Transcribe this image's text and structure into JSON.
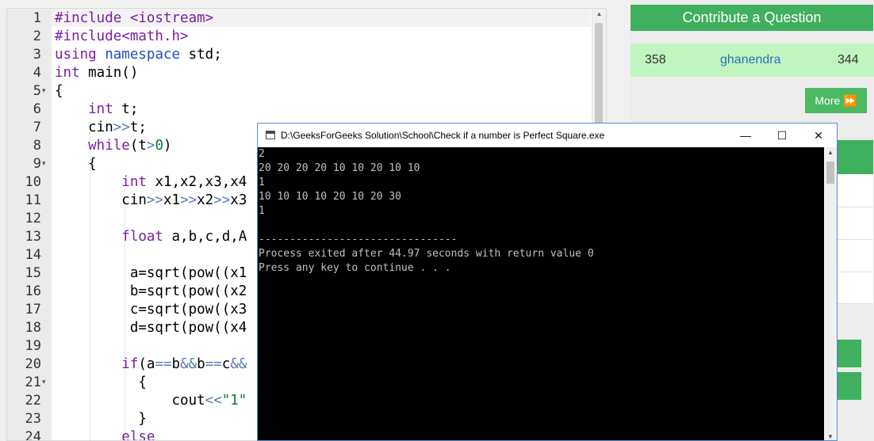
{
  "editor": {
    "line_numbers": [
      "1",
      "2",
      "3",
      "4",
      "5",
      "6",
      "7",
      "8",
      "9",
      "10",
      "11",
      "12",
      "13",
      "14",
      "15",
      "16",
      "17",
      "18",
      "19",
      "20",
      "21",
      "22",
      "23",
      "24"
    ],
    "fold_markers": [
      "5",
      "9",
      "21"
    ],
    "lines": [
      [
        {
          "t": "#include <iostream>",
          "c": "#7b1fa2"
        }
      ],
      [
        {
          "t": "#include<math.h>",
          "c": "#7b1fa2"
        }
      ],
      [
        {
          "t": "using",
          "c": "#7b1fa2"
        },
        {
          "t": " namespace",
          "c": "#1f4fb3"
        },
        {
          "t": " std;",
          "c": "#000000"
        }
      ],
      [
        {
          "t": "int",
          "c": "#7b1fa2"
        },
        {
          "t": " main()",
          "c": "#000000"
        }
      ],
      [
        {
          "t": "{",
          "c": "#000000"
        }
      ],
      [
        {
          "t": "    int",
          "c": "#7b1fa2"
        },
        {
          "t": " t;",
          "c": "#000000"
        }
      ],
      [
        {
          "t": "    cin",
          "c": "#000000"
        },
        {
          "t": ">>",
          "c": "#5b7bb8"
        },
        {
          "t": "t;",
          "c": "#000000"
        }
      ],
      [
        {
          "t": "    while",
          "c": "#7b1fa2"
        },
        {
          "t": "(t",
          "c": "#000000"
        },
        {
          "t": ">",
          "c": "#5b7bb8"
        },
        {
          "t": "0",
          "c": "#0a7a2f"
        },
        {
          "t": ")",
          "c": "#000000"
        }
      ],
      [
        {
          "t": "    {",
          "c": "#000000"
        }
      ],
      [
        {
          "t": "        int",
          "c": "#7b1fa2"
        },
        {
          "t": " x1,x2,x3,x4",
          "c": "#000000"
        }
      ],
      [
        {
          "t": "        cin",
          "c": "#000000"
        },
        {
          "t": ">>",
          "c": "#5b7bb8"
        },
        {
          "t": "x1",
          "c": "#000000"
        },
        {
          "t": ">>",
          "c": "#5b7bb8"
        },
        {
          "t": "x2",
          "c": "#000000"
        },
        {
          "t": ">>",
          "c": "#5b7bb8"
        },
        {
          "t": "x3",
          "c": "#000000"
        }
      ],
      [
        {
          "t": "",
          "c": "#000000"
        }
      ],
      [
        {
          "t": "        float",
          "c": "#7b1fa2"
        },
        {
          "t": " a,b,c,d,A",
          "c": "#000000"
        }
      ],
      [
        {
          "t": "",
          "c": "#000000"
        }
      ],
      [
        {
          "t": "         a=sqrt(pow((x1",
          "c": "#000000"
        }
      ],
      [
        {
          "t": "         b=sqrt(pow((x2",
          "c": "#000000"
        }
      ],
      [
        {
          "t": "         c=sqrt(pow((x3",
          "c": "#000000"
        }
      ],
      [
        {
          "t": "         d=sqrt(pow((x4",
          "c": "#000000"
        }
      ],
      [
        {
          "t": "",
          "c": "#000000"
        }
      ],
      [
        {
          "t": "        if",
          "c": "#7b1fa2"
        },
        {
          "t": "(a",
          "c": "#000000"
        },
        {
          "t": "==",
          "c": "#5b7bb8"
        },
        {
          "t": "b",
          "c": "#000000"
        },
        {
          "t": "&&",
          "c": "#5b7bb8"
        },
        {
          "t": "b",
          "c": "#000000"
        },
        {
          "t": "==",
          "c": "#5b7bb8"
        },
        {
          "t": "c",
          "c": "#000000"
        },
        {
          "t": "&&",
          "c": "#5b7bb8"
        }
      ],
      [
        {
          "t": "          {",
          "c": "#000000"
        }
      ],
      [
        {
          "t": "              cout",
          "c": "#000000"
        },
        {
          "t": "<<",
          "c": "#5b7bb8"
        },
        {
          "t": "\"1\"",
          "c": "#0a7a2f"
        }
      ],
      [
        {
          "t": "          }",
          "c": "#000000"
        }
      ],
      [
        {
          "t": "        else",
          "c": "#7b1fa2"
        }
      ]
    ]
  },
  "sidebar": {
    "contribute_label": "Contribute a Question",
    "leaderboard": {
      "rank": "358",
      "user": "ghanendra",
      "score": "344"
    },
    "more_label": "More ⏩"
  },
  "console": {
    "title": "D:\\GeeksForGeeks Solution\\School\\Check if a number is Perfect Square.exe",
    "minimize_glyph": "—",
    "maximize_glyph": "☐",
    "close_glyph": "✕",
    "output": [
      "2",
      "20 20 20 20 10 10 20 10 10",
      "1",
      "10 10 10 10 20 10 20 30",
      "1",
      "",
      "--------------------------------",
      "Process exited after 44.97 seconds with return value 0",
      "Press any key to continue . . ."
    ]
  },
  "colors": {
    "accent_green": "#3fb05d",
    "leader_row_bg": "#c1f5c0",
    "keyword": "#7b1fa2",
    "namespace": "#1f4fb3",
    "operator": "#5b7bb8",
    "literal": "#0a7a2f"
  },
  "icons": {
    "fold": "chevron-down-icon",
    "console_app": "console-window-icon",
    "scroll_up": "triangle-up-icon",
    "scroll_down": "triangle-down-icon",
    "more_arrow": "fast-forward-icon"
  }
}
